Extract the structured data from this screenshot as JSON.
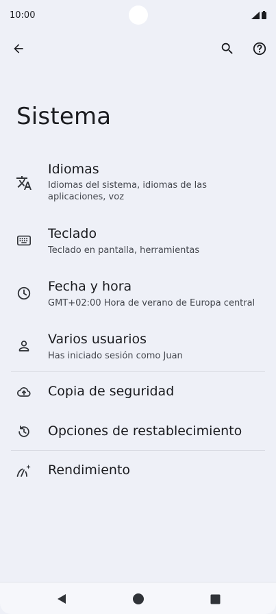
{
  "status_bar": {
    "time": "10:00"
  },
  "page": {
    "title": "Sistema"
  },
  "icons": {
    "back": "arrow-back-icon",
    "search": "search-icon",
    "help": "help-icon",
    "languages": "translate-icon",
    "keyboard": "keyboard-icon",
    "datetime": "clock-icon",
    "users": "person-icon",
    "backup": "cloud-upload-icon",
    "reset": "history-icon",
    "performance": "performance-icon"
  },
  "items": [
    {
      "title": "Idiomas",
      "subtitle": "Idiomas del sistema, idiomas de las aplicaciones, voz"
    },
    {
      "title": "Teclado",
      "subtitle": "Teclado en pantalla, herramientas"
    },
    {
      "title": "Fecha y hora",
      "subtitle": "GMT+02:00 Hora de verano de Europa central"
    },
    {
      "title": "Varios usuarios",
      "subtitle": "Has iniciado sesión como Juan"
    },
    {
      "title": "Copia de seguridad"
    },
    {
      "title": "Opciones de restablecimiento"
    },
    {
      "title": "Rendimiento"
    }
  ],
  "colors": {
    "background": "#eef0f7",
    "text": "#1b1c20",
    "secondary_text": "#44474e",
    "icon": "#303338"
  }
}
